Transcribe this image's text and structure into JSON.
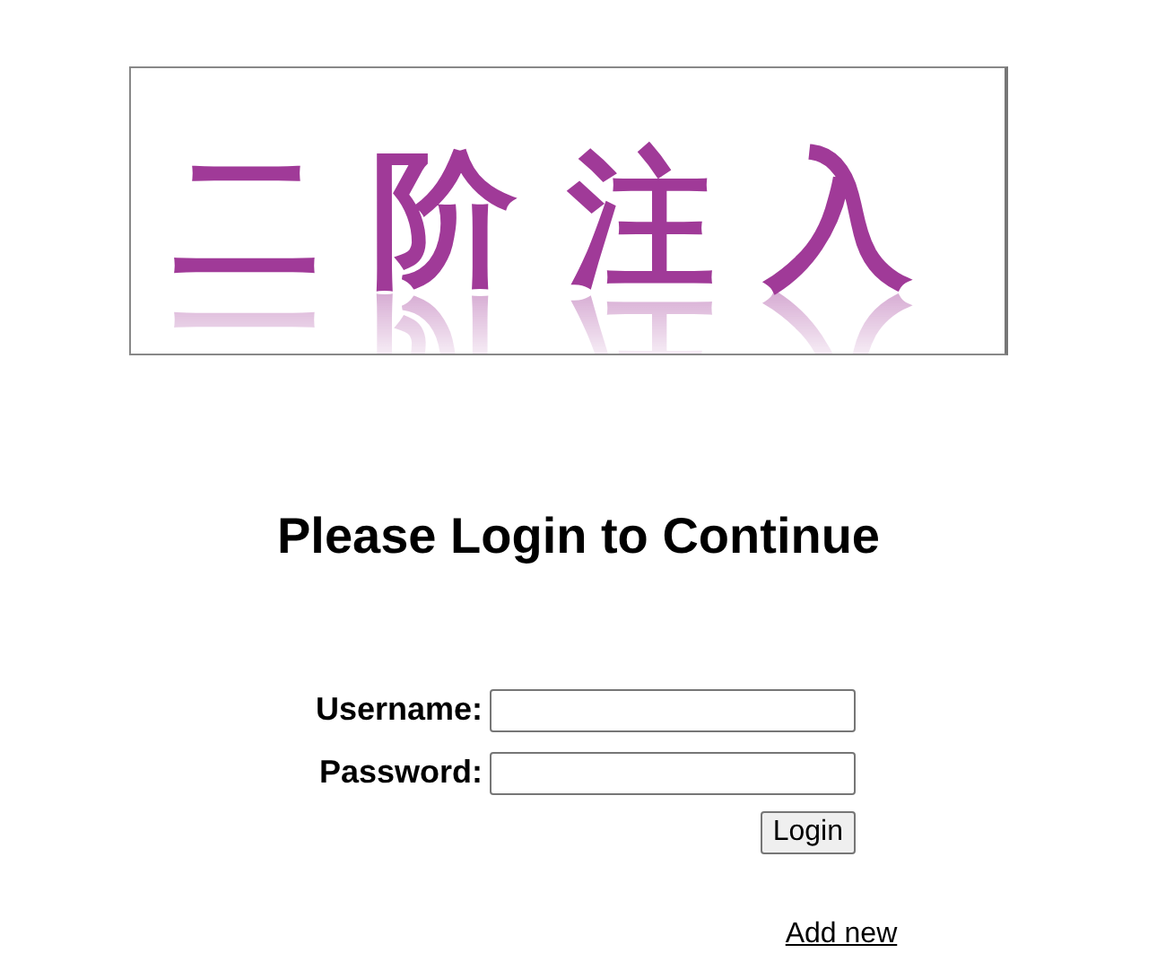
{
  "banner": {
    "text": "二阶注入"
  },
  "heading": "Please Login to Continue",
  "fields": [
    {
      "label": "Username:"
    },
    {
      "label": "Password:"
    }
  ],
  "login_button": "Login",
  "add_new_link": "Add new"
}
